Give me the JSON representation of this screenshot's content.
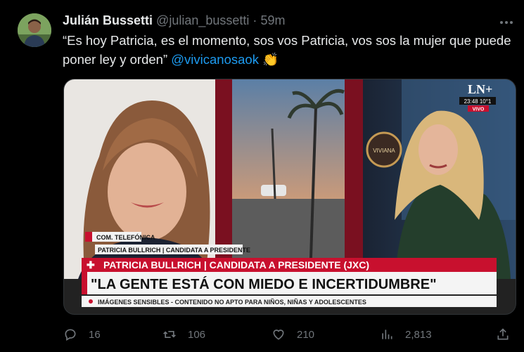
{
  "tweet": {
    "display_name": "Julián Bussetti",
    "handle": "@julian_bussetti",
    "separator": "·",
    "time": "59m",
    "text_main": "“Es hoy Patricia, es el momento, sos vos Patricia, vos sos la mujer que puede poner ley y orden”",
    "mention": "@vivicanosaok",
    "emoji": "👏"
  },
  "media": {
    "channel_logo": "LN+",
    "clock": "23:48 10°1",
    "live_badge": "VIVO",
    "studio_sign": "VIVIANA",
    "caller_tag": "COM. TELEFÓNICA",
    "caller_name": "PATRICIA BULLRICH | CANDIDATA A PRESIDENTE",
    "headline_top": "PATRICIA BULLRICH | CANDIDATA A PRESIDENTE (JXC)",
    "headline_main": "\"LA GENTE ESTÁ CON MIEDO E INCERTIDUMBRE\"",
    "ticker": "IMÁGENES SENSIBLES - CONTENIDO NO APTO PARA NIÑOS, NIÑAS Y ADOLESCENTES"
  },
  "actions": {
    "replies": "16",
    "reposts": "106",
    "likes": "210",
    "views": "2,813"
  },
  "colors": {
    "background": "#000000",
    "text": "#e7e9ea",
    "muted": "#71767b",
    "link": "#1d9bf0",
    "banner_red": "#c8102e"
  },
  "icons": [
    "more-icon",
    "reply-icon",
    "repost-icon",
    "like-icon",
    "views-icon",
    "share-icon"
  ]
}
